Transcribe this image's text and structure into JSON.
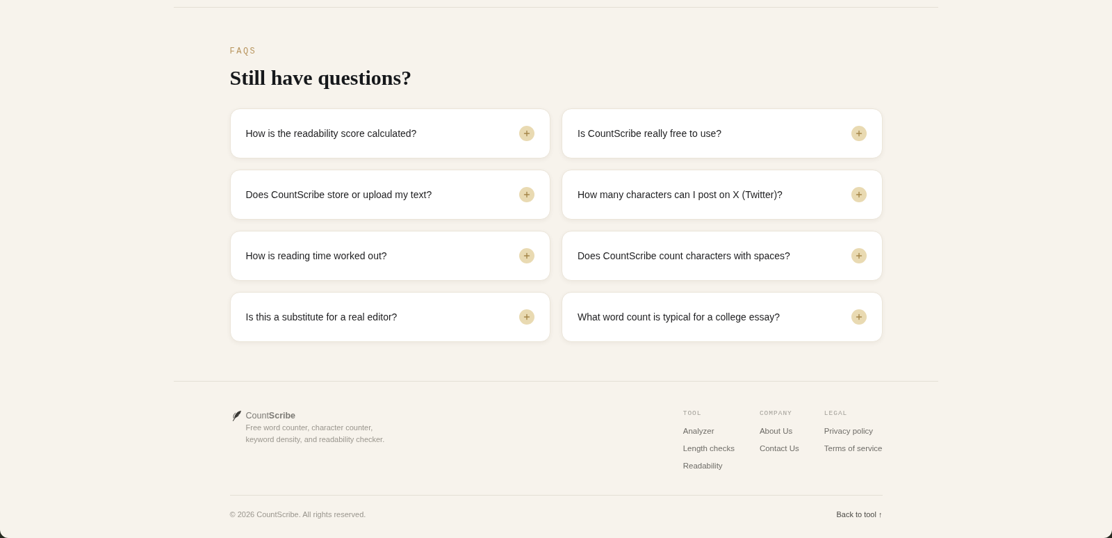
{
  "faqs": {
    "eyebrow": "FAQS",
    "title": "Still have questions?",
    "items": [
      {
        "question": "How is the readability score calculated?",
        "expanded": false
      },
      {
        "question": "Is CountScribe really free to use?",
        "expanded": false
      },
      {
        "question": "Does CountScribe store or upload my text?",
        "expanded": false
      },
      {
        "question": "How many characters can I post on X (Twitter)?",
        "expanded": false
      },
      {
        "question": "How is reading time worked out?",
        "expanded": false
      },
      {
        "question": "Does CountScribe count characters with spaces?",
        "expanded": false
      },
      {
        "question": "Is this a substitute for a real editor?",
        "expanded": false
      },
      {
        "question": "What word count is typical for a college essay?",
        "expanded": false
      }
    ]
  },
  "footer": {
    "brand": {
      "name": "Count**Scribe**",
      "tagline": "Free word counter, character counter, keyword density, and readability checker."
    },
    "columns": [
      {
        "heading": "TOOL",
        "links": [
          "Analyzer",
          "Length checks",
          "Readability"
        ]
      },
      {
        "heading": "COMPANY",
        "links": [
          "About Us",
          "Contact Us"
        ]
      },
      {
        "heading": "LEGAL",
        "links": [
          "Privacy policy",
          "Terms of service"
        ]
      }
    ],
    "copyright": "© 2026 CountScribe. All rights reserved.",
    "back_link": "Back to tool ↑"
  }
}
